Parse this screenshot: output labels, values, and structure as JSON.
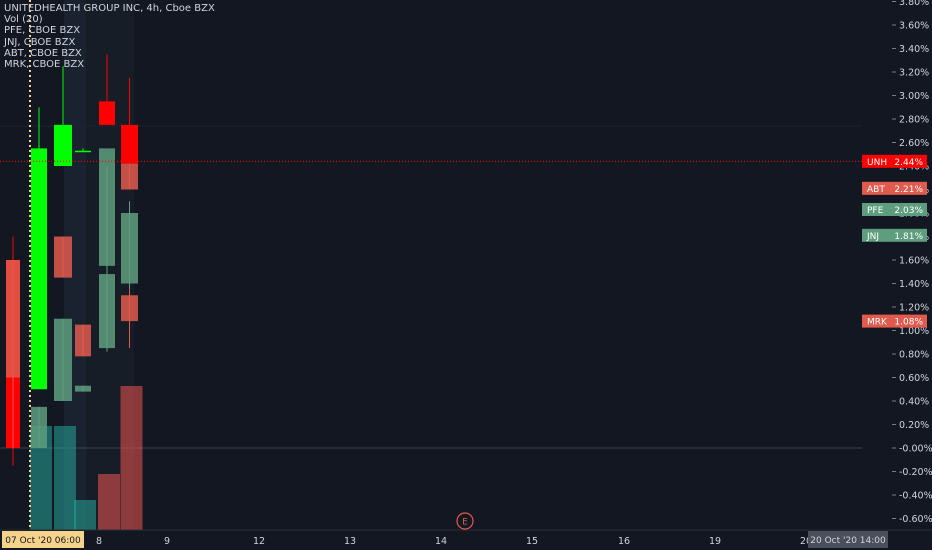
{
  "legend": {
    "main": "UNITEDHEALTH GROUP INC, 4h, Cboe BZX",
    "vol": "Vol (20)",
    "series": [
      "PFE, CBOE BZX",
      "JNJ, CBOE BZX",
      "ABT, CBOE BZX",
      "MRK, CBOE BZX"
    ]
  },
  "price_axis": {
    "labels": [
      "3.80%",
      "3.60%",
      "3.40%",
      "3.20%",
      "3.00%",
      "2.80%",
      "2.60%",
      "2.40%",
      "2.20%",
      "2.00%",
      "1.80%",
      "1.60%",
      "1.40%",
      "1.20%",
      "1.00%",
      "0.80%",
      "0.60%",
      "0.40%",
      "0.20%",
      "-0.00%",
      "-0.20%",
      "-0.40%",
      "-0.60%"
    ],
    "values": [
      3.8,
      3.6,
      3.4,
      3.2,
      3.0,
      2.8,
      2.6,
      2.4,
      2.2,
      2.0,
      1.8,
      1.6,
      1.4,
      1.2,
      1.0,
      0.8,
      0.6,
      0.4,
      0.2,
      0.0,
      -0.2,
      -0.4,
      -0.6
    ]
  },
  "time_axis": {
    "labels": [
      "8",
      "9",
      "12",
      "13",
      "14",
      "15",
      "16",
      "19",
      "20"
    ],
    "cursor_start": "07 Oct '20   06:00",
    "cursor_end": "20 Oct '20   14:00"
  },
  "tags": [
    {
      "symbol": "UNH",
      "value": "2.44%",
      "level": 2.44,
      "color": "#ff0000"
    },
    {
      "symbol": "ABT",
      "value": "2.21%",
      "level": 2.21,
      "color": "#e05a4e"
    },
    {
      "symbol": "PFE",
      "value": "2.03%",
      "level": 2.03,
      "color": "#5e9e7e"
    },
    {
      "symbol": "JNJ",
      "value": "1.81%",
      "level": 1.81,
      "color": "#5e9e7e"
    },
    {
      "symbol": "MRK",
      "value": "1.08%",
      "level": 1.08,
      "color": "#e05a4e"
    }
  ],
  "event_marker": "E",
  "chart_data": {
    "type": "candlestick",
    "y_unit": "%",
    "ylim": [
      -0.65,
      3.85
    ],
    "series": [
      {
        "name": "UNH",
        "color_up": "#00ff00",
        "color_down": "#ff0000",
        "candles": [
          {
            "slot": 0,
            "o": 1.6,
            "h": 1.8,
            "l": -0.15,
            "c": 0.0
          },
          {
            "slot": 1,
            "o": 0.5,
            "h": 2.9,
            "l": 0.5,
            "c": 2.55
          },
          {
            "slot": 2,
            "o": 2.4,
            "h": 3.25,
            "l": 2.4,
            "c": 2.75
          },
          {
            "slot": 3,
            "o": 2.53,
            "h": 2.55,
            "l": 2.52,
            "c": 2.53
          },
          {
            "slot": 4,
            "o": 2.95,
            "h": 3.35,
            "l": 2.75,
            "c": 2.75
          },
          {
            "slot": 5,
            "o": 2.75,
            "h": 3.15,
            "l": 2.42,
            "c": 2.42
          }
        ]
      },
      {
        "name": "ABT",
        "color_up": "#5e9e7e",
        "color_down": "#e05a4e",
        "candles": [
          {
            "slot": 0,
            "o": 1.6,
            "h": 1.6,
            "l": 0.0,
            "c": 0.6
          },
          {
            "slot": 2,
            "o": 1.8,
            "h": 1.8,
            "l": 1.45,
            "c": 1.45
          },
          {
            "slot": 3,
            "o": 1.05,
            "h": 1.05,
            "l": 0.78,
            "c": 0.78
          },
          {
            "slot": 5,
            "o": 2.42,
            "h": 2.42,
            "l": 2.2,
            "c": 2.2
          }
        ]
      },
      {
        "name": "PFE",
        "color_up": "#5e9e7e",
        "color_down": "#e05a4e",
        "candles": [
          {
            "slot": 2,
            "o": 0.4,
            "h": 1.1,
            "l": 0.4,
            "c": 1.1
          },
          {
            "slot": 4,
            "o": 1.55,
            "h": 2.4,
            "l": 1.45,
            "c": 2.55
          },
          {
            "slot": 5,
            "o": 1.4,
            "h": 2.1,
            "l": 1.35,
            "c": 2.0
          }
        ]
      },
      {
        "name": "JNJ",
        "color_up": "#5e9e7e",
        "color_down": "#e05a4e",
        "candles": [
          {
            "slot": 1,
            "o": 0.0,
            "h": 0.35,
            "l": 0.0,
            "c": 0.35
          },
          {
            "slot": 3,
            "o": 0.48,
            "h": 0.53,
            "l": 0.48,
            "c": 0.53
          },
          {
            "slot": 4,
            "o": 0.85,
            "h": 1.5,
            "l": 0.82,
            "c": 1.48
          }
        ]
      },
      {
        "name": "MRK",
        "color_up": "#5e9e7e",
        "color_down": "#e05a4e",
        "candles": [
          {
            "slot": 5,
            "o": 1.3,
            "h": 1.35,
            "l": 0.85,
            "c": 1.08
          }
        ]
      }
    ],
    "volume": [
      {
        "slot": 0,
        "v": 0.0,
        "color": "#26a69a"
      },
      {
        "slot": 1,
        "v": 0.52,
        "color": "#26a69a"
      },
      {
        "slot": 2,
        "v": 0.52,
        "color": "#26a69a"
      },
      {
        "slot": 3,
        "v": 0.15,
        "color": "#26a69a"
      },
      {
        "slot": 4,
        "v": 0.28,
        "color": "#ef5350"
      },
      {
        "slot": 5,
        "v": 0.72,
        "color": "#ef5350"
      }
    ]
  }
}
